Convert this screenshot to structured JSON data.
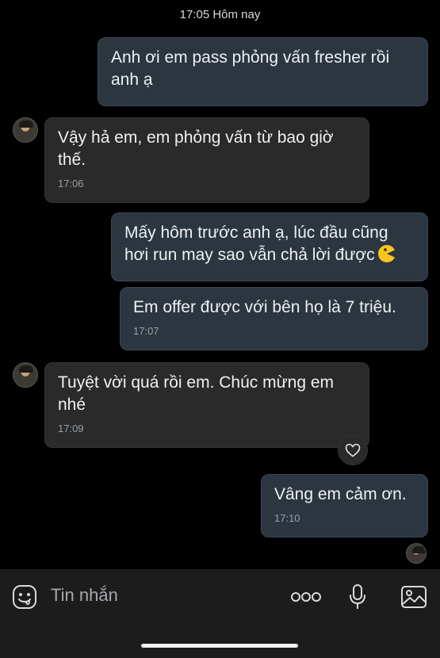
{
  "header": {
    "timestamp": "17:05 Hôm nay"
  },
  "messages": [
    {
      "sender": "me",
      "text": "Anh ơi em pass phỏng vấn fresher rồi anh ạ",
      "time": ""
    },
    {
      "sender": "other",
      "text": "Vậy hả em, em phỏng vấn từ bao giờ thế.",
      "time": "17:06"
    },
    {
      "sender": "me",
      "text": "Mấy hôm trước anh ạ, lúc đầu cũng hơi run may sao vẫn chả lời được",
      "time": ""
    },
    {
      "sender": "me",
      "text": "Em offer được với bên họ là 7 triệu.",
      "time": "17:07"
    },
    {
      "sender": "other",
      "text": "Tuyệt vời quá rồi em. Chúc mừng em nhé",
      "time": "17:09"
    },
    {
      "sender": "me",
      "text": "Vâng em cảm ơn.",
      "time": "17:10"
    }
  ],
  "input": {
    "placeholder": "Tin nhắn"
  },
  "icons": {
    "sticker": "sticker-icon",
    "more": "more-options-icon",
    "mic": "microphone-icon",
    "image": "image-icon",
    "like": "heart-icon",
    "emoji": "pacman-emoji-icon"
  }
}
